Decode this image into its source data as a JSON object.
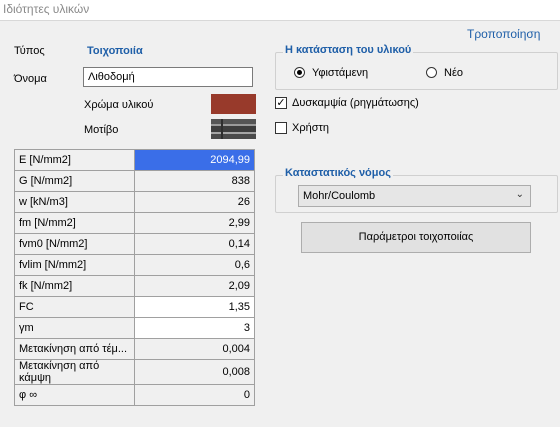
{
  "window": {
    "title": "Ιδιότητες υλικών"
  },
  "header": {
    "modify_link": "Τροποποίηση"
  },
  "material": {
    "type_label": "Τύπος",
    "type_value": "Τοιχοποιία",
    "name_label": "Όνομα",
    "name_value": "Λιθοδομή",
    "color_label": "Χρώμα υλικού",
    "color_hex": "#983a2b",
    "pattern_label": "Μοτίβο",
    "pattern_icon": "stone-texture"
  },
  "properties": [
    {
      "label": "E [N/mm2]",
      "value": "2094,99",
      "state": "selected"
    },
    {
      "label": "G [N/mm2]",
      "value": "838",
      "state": "readonly"
    },
    {
      "label": "w [kN/m3]",
      "value": "26",
      "state": "readonly"
    },
    {
      "label": "fm [N/mm2]",
      "value": "2,99",
      "state": "readonly"
    },
    {
      "label": "fvm0 [N/mm2]",
      "value": "0,14",
      "state": "readonly"
    },
    {
      "label": "fvlim [N/mm2]",
      "value": "0,6",
      "state": "readonly"
    },
    {
      "label": "fk [N/mm2]",
      "value": "2,09",
      "state": "readonly"
    },
    {
      "label": "FC",
      "value": "1,35",
      "state": "editable"
    },
    {
      "label": "γm",
      "value": "3",
      "state": "editable"
    },
    {
      "label": "Μετακίνηση από τέμ...",
      "value": "0,004",
      "state": "readonly"
    },
    {
      "label": "Μετακίνηση από κάμψη",
      "value": "0,008",
      "state": "readonly"
    },
    {
      "label": "φ ∞",
      "value": "0",
      "state": "readonly"
    }
  ],
  "state_group": {
    "title": "Η κατάσταση του υλικού",
    "existing_label": "Υφιστάμενη",
    "new_label": "Νέο",
    "selected": "existing"
  },
  "options": {
    "stiffness_label": "Δυσκαμψία (ρηγμάτωσης)",
    "stiffness_checked": true,
    "user_label": "Χρήστη",
    "user_checked": false
  },
  "constitutive": {
    "title": "Καταστατικός νόμος",
    "selected": "Mohr/Coulomb"
  },
  "masonry_params_button": "Παράμετροι τοιχοποιίας",
  "colors": {
    "accent": "#1f5fa8",
    "selection": "#3a6ee8"
  }
}
